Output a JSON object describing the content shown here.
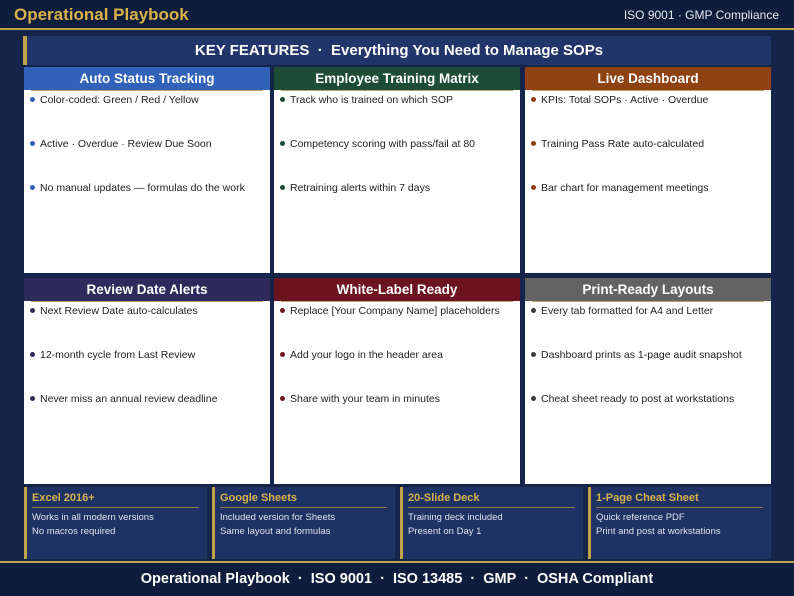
{
  "header": {
    "title": "Operational Playbook",
    "compliance": "ISO 9001 · GMP Compliance"
  },
  "banner": {
    "text": "KEY FEATURES  ·  Everything You Need to Manage SOPs"
  },
  "cards": [
    {
      "title": "Auto Status Tracking",
      "color": "#2f62b8",
      "bullet_color": "#2f62b8",
      "items": [
        "Color-coded: Green / Red / Yellow",
        "Active · Overdue · Review Due Soon",
        "No manual updates — formulas do the work"
      ]
    },
    {
      "title": "Employee Training Matrix",
      "color": "#1e4d36",
      "bullet_color": "#1e4d36",
      "items": [
        "Track who is trained on which SOP",
        "Competency scoring with pass/fail at 80",
        "Retraining alerts within 7 days"
      ]
    },
    {
      "title": "Live Dashboard",
      "color": "#8e4212",
      "bullet_color": "#8e4212",
      "items": [
        "KPIs: Total SOPs · Active · Overdue",
        "Training Pass Rate auto-calculated",
        "Bar chart for management meetings"
      ]
    },
    {
      "title": "Review Date Alerts",
      "color": "#2e2a5c",
      "bullet_color": "#2e2a5c",
      "items": [
        "Next Review Date auto-calculates",
        "12-month cycle from Last Review",
        "Never miss an annual review deadline"
      ]
    },
    {
      "title": "White-Label Ready",
      "color": "#6b1420",
      "bullet_color": "#6b1420",
      "items": [
        "Replace [Your Company Name] placeholders",
        "Add your logo in the header area",
        "Share with your team in minutes"
      ]
    },
    {
      "title": "Print-Ready Layouts",
      "color": "#636363",
      "bullet_color": "#3a3a3a",
      "items": [
        "Every tab formatted for A4 and Letter",
        "Dashboard prints as 1-page audit snapshot",
        "Cheat sheet ready to post at workstations"
      ]
    }
  ],
  "info_boxes": [
    {
      "title": "Excel 2016+",
      "lines": [
        "Works in all modern versions",
        "No macros required"
      ]
    },
    {
      "title": "Google Sheets",
      "lines": [
        "Included version for Sheets",
        "Same layout and formulas"
      ]
    },
    {
      "title": "20-Slide Deck",
      "lines": [
        "Training deck included",
        "Present on Day 1"
      ]
    },
    {
      "title": "1-Page Cheat Sheet",
      "lines": [
        "Quick reference PDF",
        "Print and post at workstations"
      ]
    }
  ],
  "footer": {
    "text": "Operational Playbook  ·  ISO 9001  ·  ISO 13485  ·  GMP  ·  OSHA Compliant"
  },
  "colors": {
    "background": "#15254a",
    "gold": "#c4a24a"
  }
}
